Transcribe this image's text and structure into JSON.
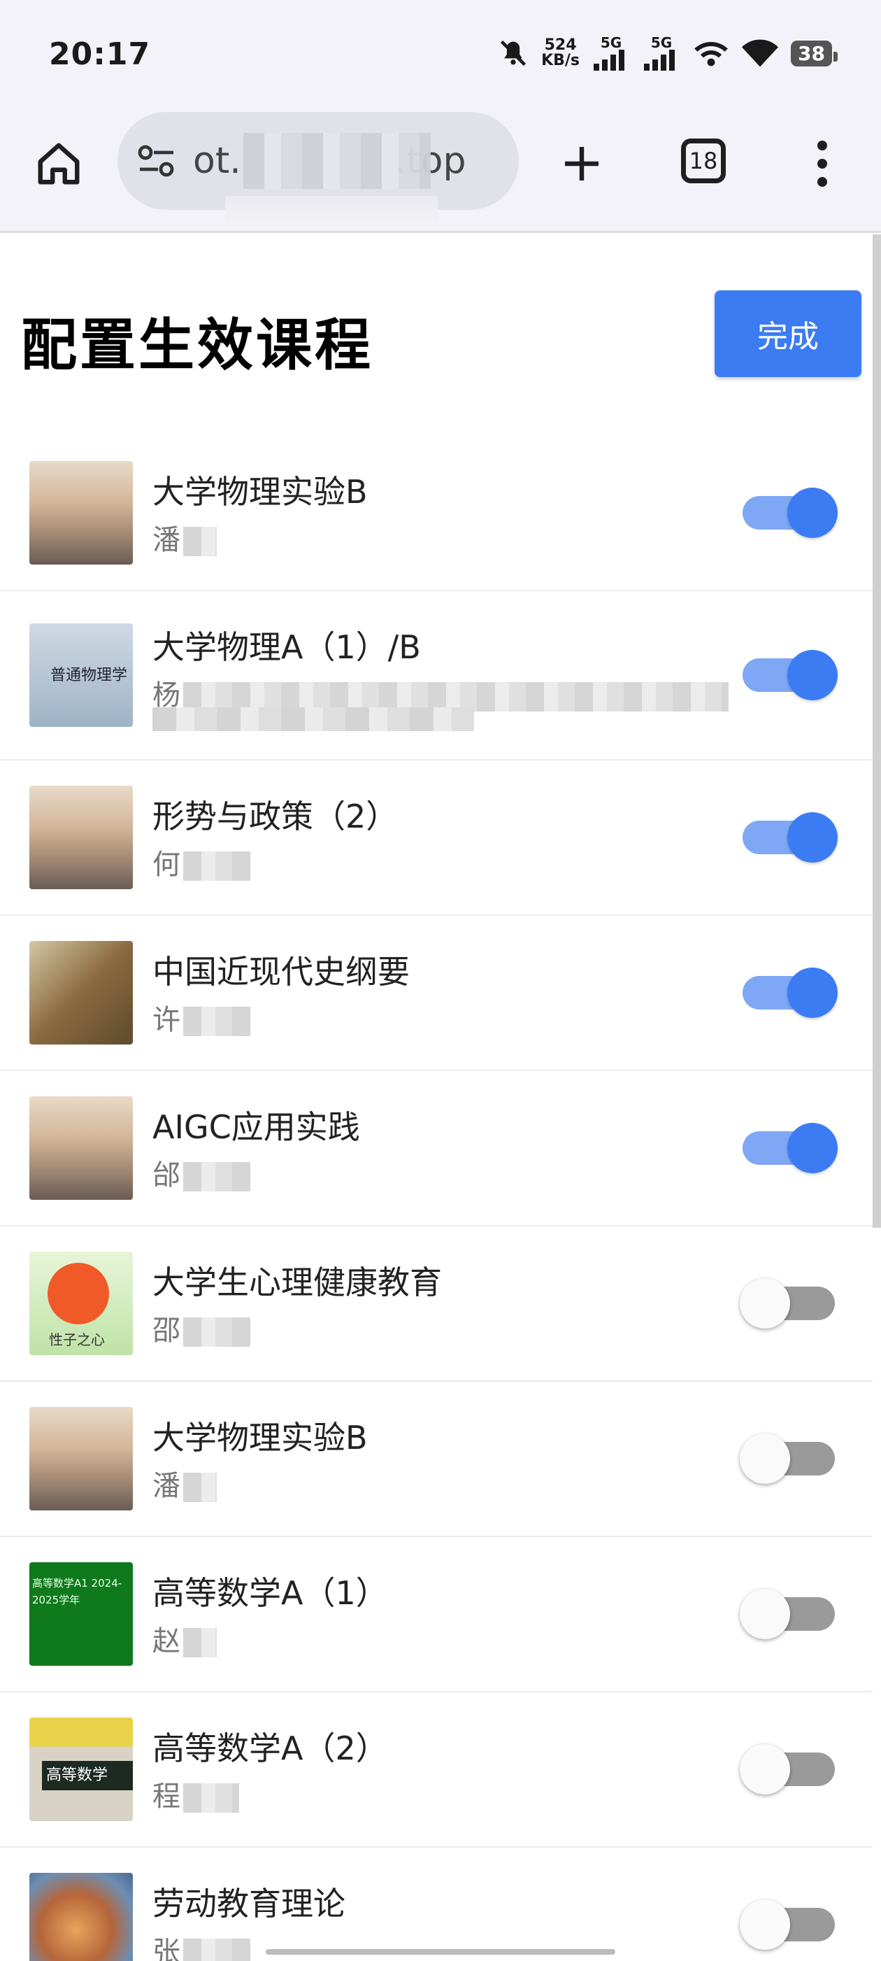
{
  "status_bar": {
    "time": "20:17",
    "net_speed_value": "524",
    "net_speed_unit": "KB/s",
    "sim1": "5G",
    "sim2": "5G",
    "battery": "38"
  },
  "browser": {
    "url_prefix": "ot.",
    "url_suffix": ".top",
    "tab_count": "18"
  },
  "page": {
    "title": "配置生效课程",
    "done_label": "完成"
  },
  "courses": [
    {
      "name": "大学物理实验B",
      "teacher": "潘",
      "enabled": true
    },
    {
      "name": "大学物理A（1）/B",
      "teacher": "杨",
      "enabled": true
    },
    {
      "name": "形势与政策（2）",
      "teacher": "何",
      "enabled": true
    },
    {
      "name": "中国近现代史纲要",
      "teacher": "许",
      "enabled": true
    },
    {
      "name": "AIGC应用实践",
      "teacher": "邰",
      "enabled": true
    },
    {
      "name": "大学生心理健康教育",
      "teacher": "邵",
      "enabled": false
    },
    {
      "name": "大学物理实验B",
      "teacher": "潘",
      "enabled": false
    },
    {
      "name": "高等数学A（1）",
      "teacher": "赵",
      "enabled": false
    },
    {
      "name": "高等数学A（2）",
      "teacher": "程",
      "enabled": false
    },
    {
      "name": "劳动教育理论",
      "teacher": "张",
      "enabled": false
    }
  ],
  "thumbnails": {
    "book_title": "普通物理学",
    "heart_caption": "性子之心",
    "green_text": "高等数学A1 2024-2025学年",
    "math_cover": "高等数学"
  },
  "colors": {
    "accent": "#3b7cf3",
    "toggle_track_on": "#7ea7f5",
    "toggle_track_off": "#9a9a9a"
  }
}
